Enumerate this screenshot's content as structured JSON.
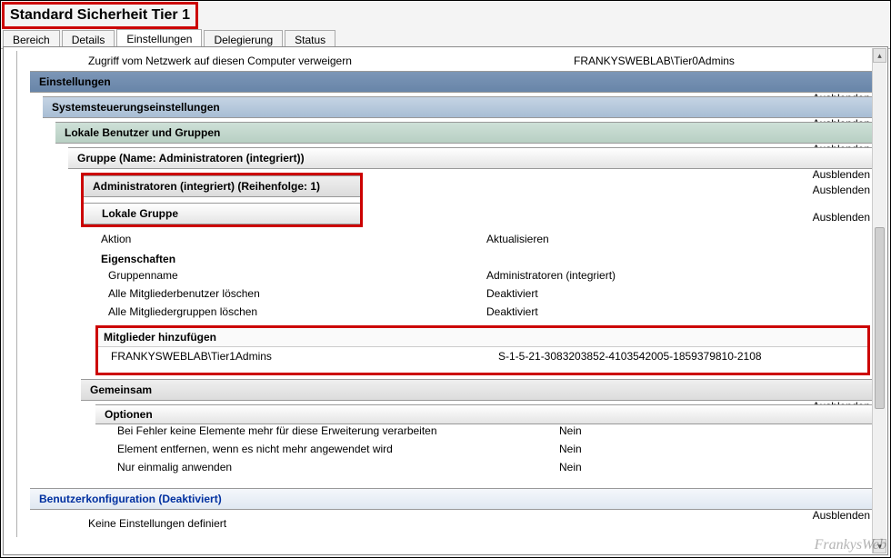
{
  "window": {
    "title": "Standard Sicherheit Tier 1"
  },
  "tabs": [
    {
      "label": "Bereich"
    },
    {
      "label": "Details"
    },
    {
      "label": "Einstellungen",
      "active": true
    },
    {
      "label": "Delegierung"
    },
    {
      "label": "Status"
    }
  ],
  "top_row": {
    "label": "Zugriff vom Netzwerk auf diesen Computer verweigern",
    "value": "FRANKYSWEBLAB\\Tier0Admins"
  },
  "hide_label": "Ausblenden",
  "headers": {
    "einstellungen": "Einstellungen",
    "systemsteuerung": "Systemsteuerungseinstellungen",
    "lokale_benutzer": "Lokale Benutzer und Gruppen",
    "gruppe": "Gruppe (Name: Administratoren (integriert))",
    "admins_integr": "Administratoren (integriert) (Reihenfolge: 1)",
    "lokale_gruppe": "Lokale Gruppe",
    "gemeinsam": "Gemeinsam",
    "optionen": "Optionen",
    "benutzerkonfig": "Benutzerkonfiguration (Deaktiviert)"
  },
  "action_row": {
    "label": "Aktion",
    "value": "Aktualisieren"
  },
  "eigenschaften": {
    "title": "Eigenschaften",
    "rows": [
      {
        "label": "Gruppenname",
        "value": "Administratoren (integriert)"
      },
      {
        "label": "Alle Mitgliederbenutzer löschen",
        "value": "Deaktiviert"
      },
      {
        "label": "Alle Mitgliedergruppen löschen",
        "value": "Deaktiviert"
      }
    ]
  },
  "mitglieder": {
    "title": "Mitglieder hinzufügen",
    "rows": [
      {
        "name": "FRANKYSWEBLAB\\Tier1Admins",
        "sid": "S-1-5-21-3083203852-4103542005-1859379810-2108"
      }
    ]
  },
  "optionen_rows": [
    {
      "label": "Bei Fehler keine Elemente mehr für diese Erweiterung verarbeiten",
      "value": "Nein"
    },
    {
      "label": "Element entfernen, wenn es nicht mehr angewendet wird",
      "value": "Nein"
    },
    {
      "label": "Nur einmalig anwenden",
      "value": "Nein"
    }
  ],
  "bottom_line": "Keine Einstellungen definiert",
  "watermark": "FrankysWeb"
}
